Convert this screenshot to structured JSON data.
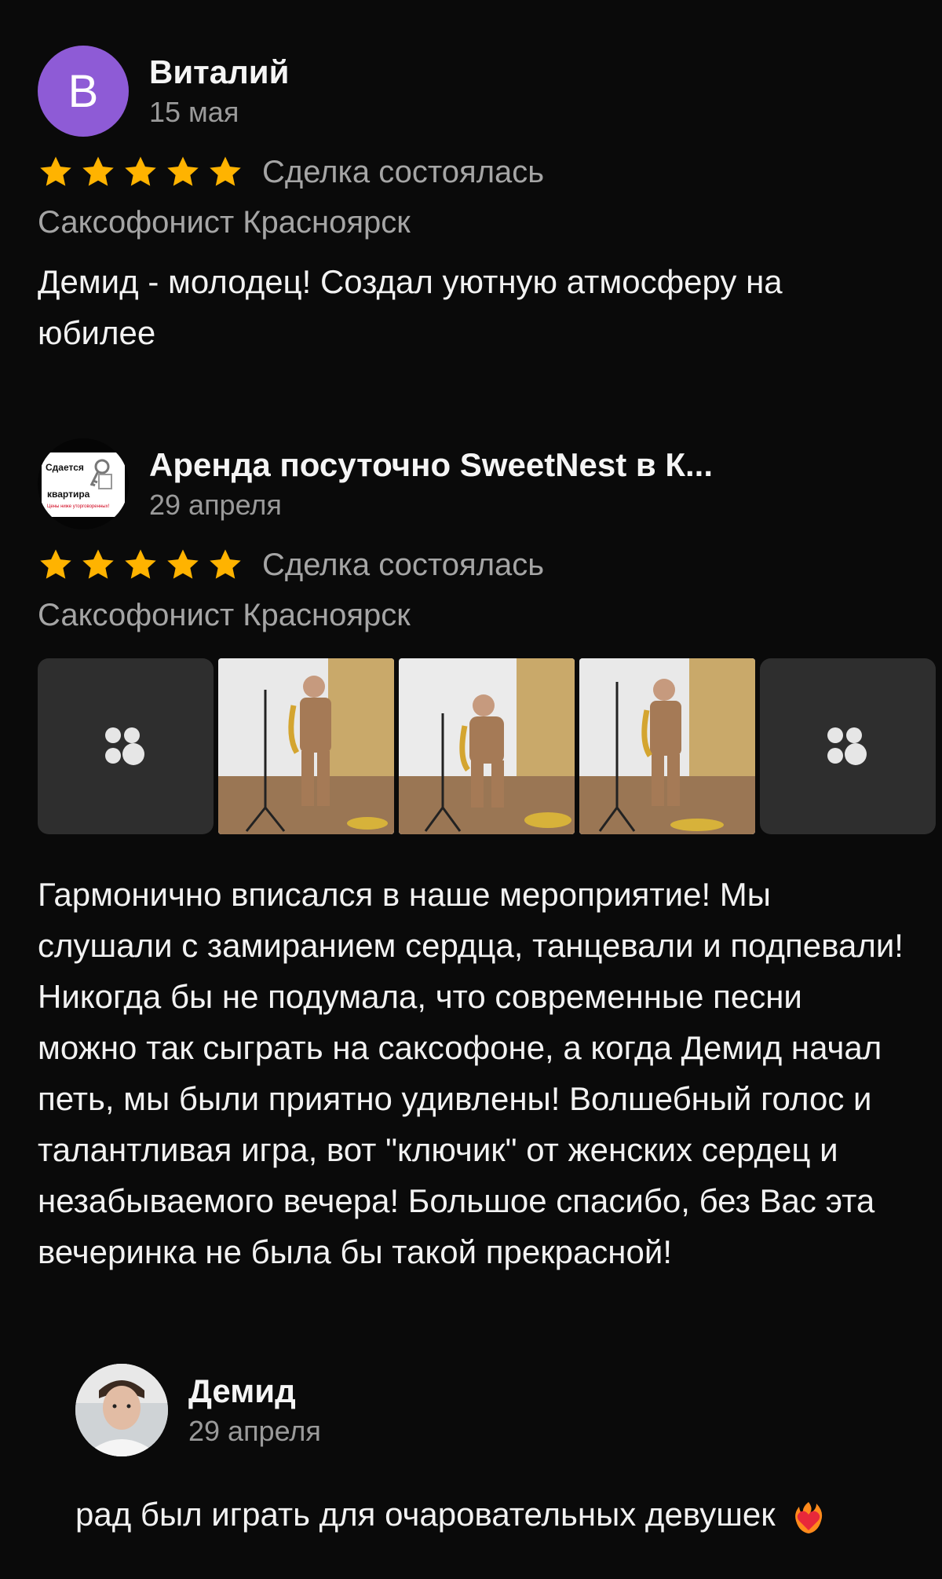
{
  "reviews": [
    {
      "avatar_letter": "В",
      "author": "Виталий",
      "date": "15 мая",
      "rating": 5,
      "deal_status": "Сделка состоялась",
      "category": "Саксофонист Красноярск",
      "text": "Демид - молодец! Создал уютную атмосферу на юбилее"
    },
    {
      "avatar_logo": {
        "line1": "Сдается",
        "line2": "квартира",
        "line3": "Цены ниже уторговоренных!"
      },
      "author": "Аренда посуточно SweetNest в К...",
      "date": "29 апреля",
      "rating": 5,
      "deal_status": "Сделка состоялась",
      "category": "Саксофонист Красноярск",
      "text": "Гармонично вписался в наше мероприятие!  Мы слушали с замиранием сердца, танцевали и подпевали! Никогда бы не подумала, что современные песни можно так сыграть на саксофоне, а когда Демид начал петь, мы были приятно удивлены! Волшебный голос и талантливая игра, вот \"ключик\" от женских сердец и незабываемого вечера! Большое спасибо, без Вас эта вечеринка не была бы такой прекрасной!",
      "photos": [
        "placeholder",
        "photo",
        "photo",
        "photo",
        "placeholder"
      ]
    }
  ],
  "reply": {
    "author": "Демид",
    "date": "29 апреля",
    "text": "рад был играть для очаровательных девушек",
    "emoji": "heart-on-fire-icon"
  },
  "colors": {
    "background": "#0a0a0a",
    "star": "#ffb300",
    "avatar_purple": "#8e5bd6",
    "secondary_text": "#a5a5a5"
  }
}
